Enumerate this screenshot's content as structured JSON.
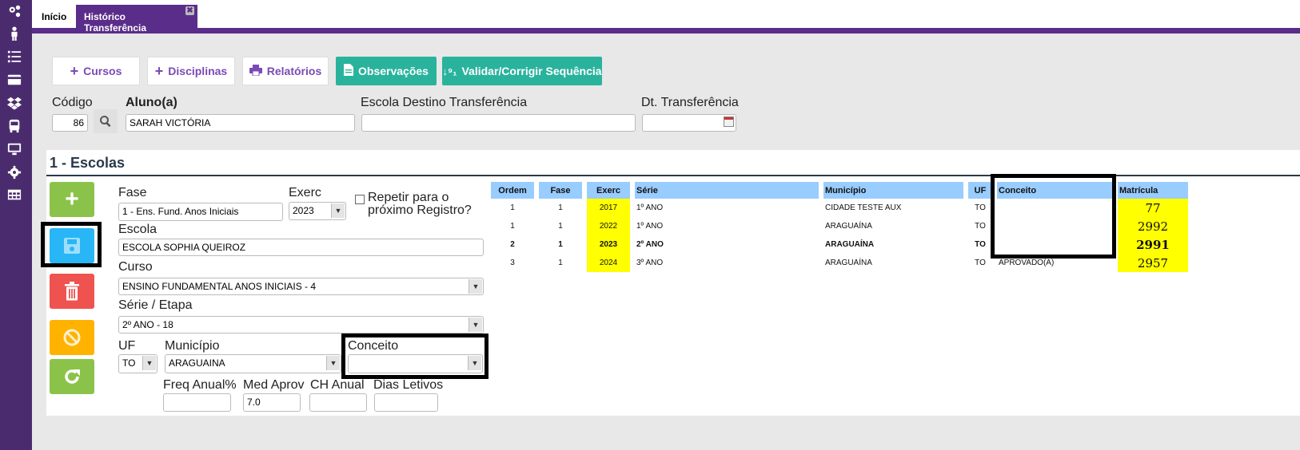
{
  "sidebar": {
    "icons": [
      "gears-icon",
      "person-icon",
      "list-icon",
      "card-icon",
      "dropbox-icon",
      "bus-icon",
      "monitor-icon",
      "cog-icon",
      "table-icon"
    ]
  },
  "tabs": {
    "home": "Início",
    "current": "Histórico Transferência",
    "close": "✖"
  },
  "toolbar": {
    "cursos": "Cursos",
    "disciplinas": "Disciplinas",
    "relatorios": "Relatórios",
    "observacoes": "Observações",
    "validar": "Validar/Corrigir Sequência"
  },
  "header_form": {
    "codigo_label": "Código",
    "codigo_value": "86",
    "aluno_label": "Aluno(a)",
    "aluno_value": "SARAH VICTÓRIA",
    "escola_destino_label": "Escola Destino Transferência",
    "escola_destino_value": "",
    "dt_transferencia_label": "Dt. Transferência",
    "dt_transferencia_value": ""
  },
  "section": {
    "title": "1 - Escolas"
  },
  "form": {
    "fase_label": "Fase",
    "fase_value": "1 - Ens. Fund. Anos Iniciais",
    "exerc_label": "Exerc",
    "exerc_value": "2023",
    "repetir_line1": "Repetir para o",
    "repetir_line2": "próximo Registro?",
    "escola_label": "Escola",
    "escola_value": "ESCOLA SOPHIA QUEIROZ",
    "curso_label": "Curso",
    "curso_value": "ENSINO FUNDAMENTAL ANOS INICIAIS - 4",
    "serie_label": "Série / Etapa",
    "serie_value": "2º ANO - 18",
    "uf_label": "UF",
    "uf_value": "TO",
    "municipio_label": "Município",
    "municipio_value": "ARAGUAINA",
    "conceito_label": "Conceito",
    "conceito_value": "",
    "freq_label": "Freq Anual%",
    "freq_value": "",
    "med_label": "Med Aprov",
    "med_value": "7.0",
    "ch_label": "CH Anual",
    "ch_value": "",
    "dias_label": "Dias Letivos",
    "dias_value": ""
  },
  "side_buttons": {
    "add": "+",
    "save": "save",
    "delete": "delete",
    "cancel": "cancel",
    "refresh": "refresh"
  },
  "grid": {
    "headers": [
      "Ordem",
      "Fase",
      "Exerc",
      "Série",
      "Município",
      "UF",
      "Conceito",
      "Matrícula"
    ],
    "rows": [
      {
        "ordem": "1",
        "fase": "1",
        "exerc": "2017",
        "serie": "1º ANO",
        "municipio": "CIDADE TESTE AUX",
        "uf": "TO",
        "conceito": "",
        "matricula": "77",
        "bold": false
      },
      {
        "ordem": "1",
        "fase": "1",
        "exerc": "2022",
        "serie": "1º ANO",
        "municipio": "ARAGUAÍNA",
        "uf": "TO",
        "conceito": "",
        "matricula": "2992",
        "bold": false
      },
      {
        "ordem": "2",
        "fase": "1",
        "exerc": "2023",
        "serie": "2º ANO",
        "municipio": "ARAGUAÍNA",
        "uf": "TO",
        "conceito": "",
        "matricula": "2991",
        "bold": true
      },
      {
        "ordem": "3",
        "fase": "1",
        "exerc": "2024",
        "serie": "3º ANO",
        "municipio": "ARAGUAÍNA",
        "uf": "TO",
        "conceito": "APROVADO(A)",
        "matricula": "2957",
        "bold": false
      }
    ]
  },
  "colors": {
    "sidebar": "#4a2c6e",
    "accent": "#5b2d8a",
    "teal": "#2ab39c",
    "green": "#8bc34a",
    "blue": "#29b6f6",
    "red": "#ef5350",
    "orange": "#ffb300",
    "highlight": "#ffff00",
    "grid_header": "#99ccff"
  }
}
